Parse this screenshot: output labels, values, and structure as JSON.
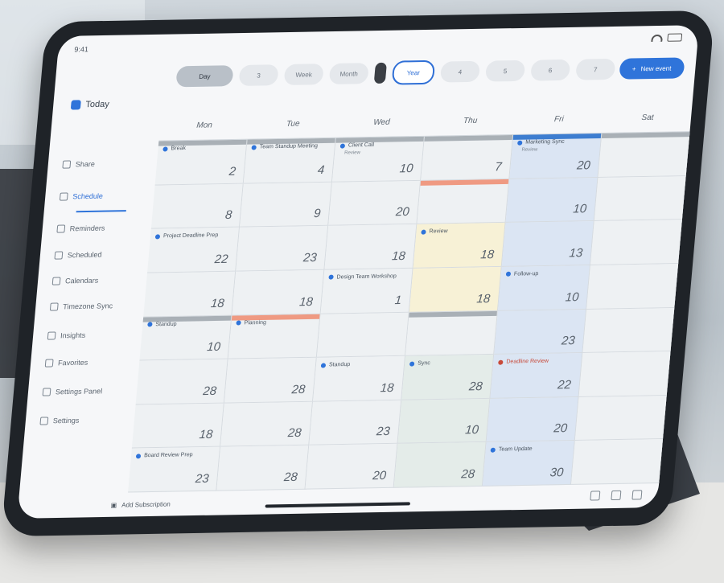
{
  "status_bar": {
    "time": "9:41"
  },
  "app": {
    "title": "Today"
  },
  "toolbar": {
    "pills": [
      "Day",
      "3",
      "Week",
      "Month",
      "",
      "Year",
      "4",
      "5",
      "6",
      "7"
    ],
    "new_event_label": "New event"
  },
  "sidebar": {
    "items": [
      {
        "icon": "calendar-icon",
        "label": "Share"
      },
      {
        "icon": "people-icon",
        "label": "Schedule"
      },
      {
        "icon": "list-icon",
        "label": "Reminders"
      },
      {
        "icon": "grid-icon",
        "label": "Scheduled"
      },
      {
        "icon": "pin-icon",
        "label": "Calendars"
      },
      {
        "icon": "clock-icon",
        "label": "Timezone Sync"
      },
      {
        "icon": "chart-icon",
        "label": "Insights"
      },
      {
        "icon": "star-icon",
        "label": "Favorites"
      },
      {
        "icon": "settings-icon",
        "label": "Settings Panel"
      },
      {
        "icon": "gear-icon",
        "label": "Settings"
      }
    ]
  },
  "calendar": {
    "weekdays": [
      "Mon",
      "Tue",
      "Wed",
      "Thu",
      "Fri",
      "Sat"
    ],
    "cells": [
      {
        "num": "2",
        "event": "Break",
        "bar": "gray"
      },
      {
        "num": "4",
        "event": "Team Standup Meeting",
        "bar": "gray"
      },
      {
        "num": "10",
        "event": "Client Call",
        "sub": "Review",
        "bar": "gray"
      },
      {
        "num": "7",
        "event": "",
        "bar": "gray"
      },
      {
        "num": "20",
        "event": "Marketing Sync",
        "sub": "Review",
        "bar": "blue",
        "bg": "hl-blue"
      },
      {
        "num": "",
        "event": "",
        "bar": "gray"
      },
      {
        "num": "8",
        "event": ""
      },
      {
        "num": "9",
        "event": ""
      },
      {
        "num": "20",
        "event": ""
      },
      {
        "num": "",
        "event": "",
        "bar": "orange"
      },
      {
        "num": "10",
        "event": "",
        "bg": "hl-blue"
      },
      {
        "num": "",
        "event": ""
      },
      {
        "num": "22",
        "event": "Project Deadline Prep"
      },
      {
        "num": "23",
        "event": ""
      },
      {
        "num": "18",
        "event": ""
      },
      {
        "num": "18",
        "event": "Review",
        "bg": "hl-yellow"
      },
      {
        "num": "13",
        "event": "",
        "bg": "hl-blue"
      },
      {
        "num": "",
        "event": ""
      },
      {
        "num": "18",
        "event": ""
      },
      {
        "num": "18",
        "event": ""
      },
      {
        "num": "1",
        "event": "Design Team Workshop"
      },
      {
        "num": "18",
        "event": "",
        "bg": "hl-yellow"
      },
      {
        "num": "10",
        "event": "Follow-up",
        "bg": "hl-blue"
      },
      {
        "num": "",
        "event": ""
      },
      {
        "num": "10",
        "event": "Standup",
        "bar": "gray"
      },
      {
        "num": "",
        "event": "Planning",
        "bar": "orange"
      },
      {
        "num": "",
        "event": ""
      },
      {
        "num": "",
        "event": "",
        "bar": "gray"
      },
      {
        "num": "23",
        "event": "",
        "bg": "hl-blue"
      },
      {
        "num": "",
        "event": ""
      },
      {
        "num": "28",
        "event": ""
      },
      {
        "num": "28",
        "event": ""
      },
      {
        "num": "18",
        "event": "Standup"
      },
      {
        "num": "28",
        "event": "Sync",
        "bg": "hl-green"
      },
      {
        "num": "22",
        "event": "Deadline Review",
        "red": true,
        "bg": "hl-blue"
      },
      {
        "num": "",
        "event": ""
      },
      {
        "num": "18",
        "event": ""
      },
      {
        "num": "28",
        "event": ""
      },
      {
        "num": "23",
        "event": ""
      },
      {
        "num": "10",
        "event": "",
        "bg": "hl-green"
      },
      {
        "num": "20",
        "event": "",
        "bg": "hl-blue"
      },
      {
        "num": "",
        "event": ""
      },
      {
        "num": "23",
        "event": "Board Review Prep"
      },
      {
        "num": "28",
        "event": ""
      },
      {
        "num": "20",
        "event": ""
      },
      {
        "num": "28",
        "event": "",
        "bg": "hl-green"
      },
      {
        "num": "30",
        "event": "Team Update",
        "bg": "hl-blue"
      },
      {
        "num": "",
        "event": ""
      }
    ]
  },
  "footer": {
    "label": "Add Subscription"
  }
}
